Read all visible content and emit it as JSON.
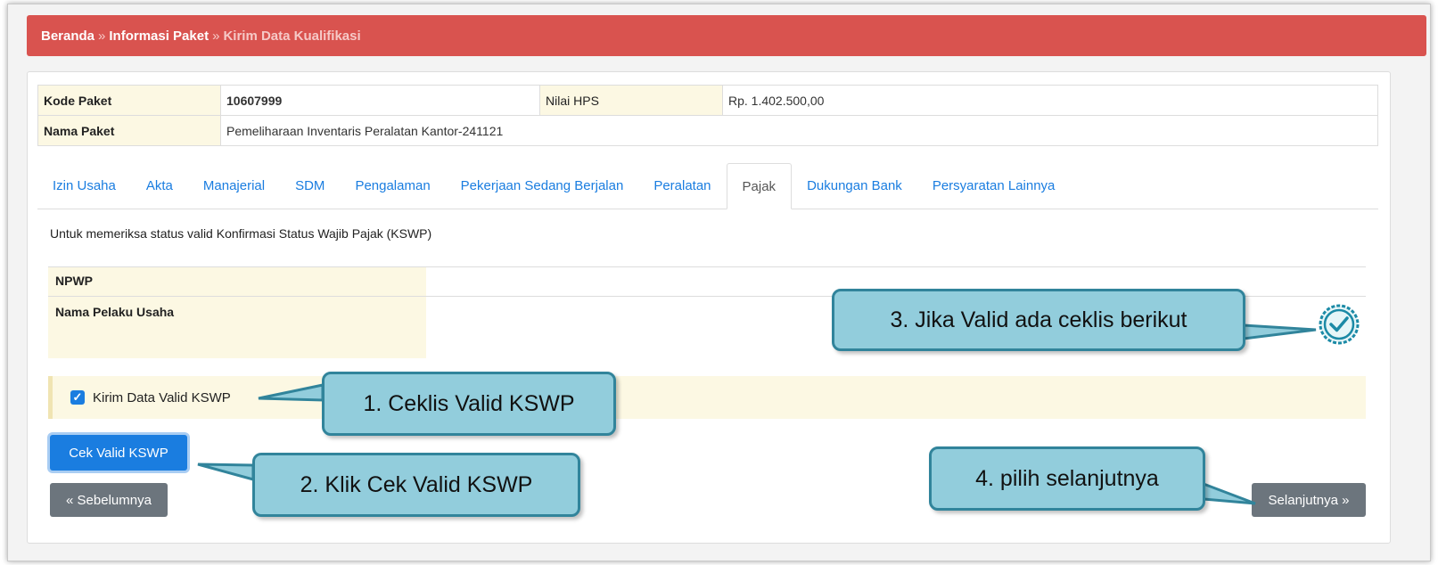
{
  "breadcrumb": {
    "home": "Beranda",
    "separator": "»",
    "info": "Informasi Paket",
    "current": "Kirim Data Kualifikasi"
  },
  "package": {
    "kode_label": "Kode Paket",
    "kode_value": "10607999",
    "hps_label": "Nilai HPS",
    "hps_value": "Rp. 1.402.500,00",
    "nama_label": "Nama Paket",
    "nama_value": "Pemeliharaan Inventaris Peralatan Kantor-241121"
  },
  "tabs": [
    {
      "label": "Izin Usaha"
    },
    {
      "label": "Akta"
    },
    {
      "label": "Manajerial"
    },
    {
      "label": "SDM"
    },
    {
      "label": "Pengalaman"
    },
    {
      "label": "Pekerjaan Sedang Berjalan"
    },
    {
      "label": "Peralatan"
    },
    {
      "label": "Pajak"
    },
    {
      "label": "Dukungan Bank"
    },
    {
      "label": "Persyaratan Lainnya"
    }
  ],
  "active_tab": "Pajak",
  "pajak": {
    "description": "Untuk memeriksa status valid Konfirmasi Status Wajib Pajak (KSWP)",
    "npwp_label": "NPWP",
    "nama_label": "Nama Pelaku Usaha",
    "checkbox_label": "Kirim Data Valid KSWP",
    "checkbox_checked": true,
    "cek_button": "Cek Valid KSWP",
    "prev_button": "« Sebelumnya",
    "next_button": "Selanjutnya »"
  },
  "callouts": {
    "c1": "1. Ceklis Valid KSWP",
    "c2": "2. Klik Cek Valid KSWP",
    "c3": "3. Jika Valid ada ceklis berikut",
    "c4": "4. pilih selanjutnya"
  },
  "colors": {
    "header": "#d9534f",
    "primary": "#1a7de0",
    "secondary": "#6c757d",
    "callout_fill": "#92cddc",
    "callout_border": "#31849b",
    "label_bg": "#fcf8e3"
  },
  "icons": {
    "valid_check": "check-circle-icon"
  }
}
